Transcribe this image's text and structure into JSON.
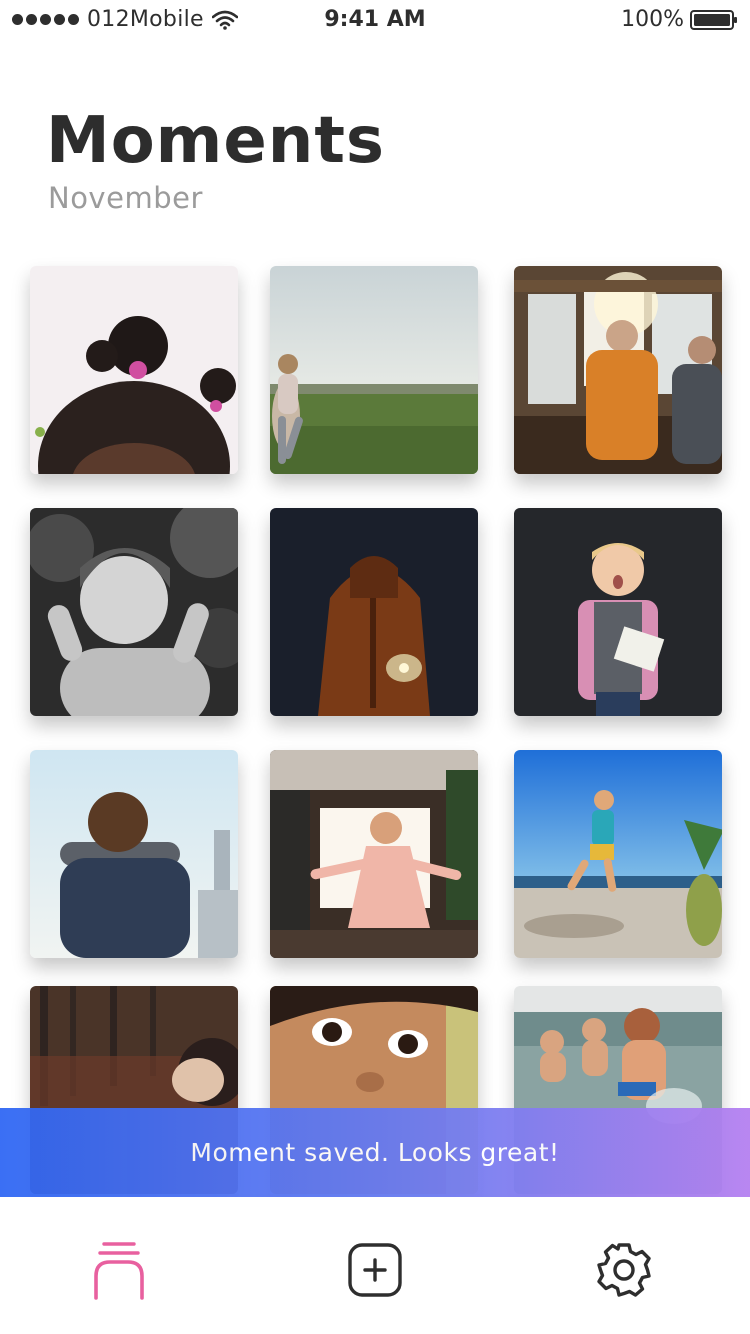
{
  "status_bar": {
    "carrier": "012Mobile",
    "time": "9:41 AM",
    "battery": "100%"
  },
  "header": {
    "title": "Moments",
    "subtitle": "November"
  },
  "grid": {
    "photos": [
      {
        "subject": "child-hair-buns"
      },
      {
        "subject": "girl-running-field"
      },
      {
        "subject": "men-at-window"
      },
      {
        "subject": "boy-black-white"
      },
      {
        "subject": "child-with-sparkler"
      },
      {
        "subject": "surprised-boy-with-book"
      },
      {
        "subject": "child-at-binoculars"
      },
      {
        "subject": "girl-dancing"
      },
      {
        "subject": "boy-on-beach"
      },
      {
        "subject": "child-in-forest"
      },
      {
        "subject": "child-close-up"
      },
      {
        "subject": "kids-in-water"
      }
    ]
  },
  "toast": {
    "message": "Moment saved. Looks great!",
    "colors": [
      "#2e66f3",
      "#b47ff0"
    ]
  },
  "tab_bar": {
    "items": [
      {
        "icon": "moments-stack-icon",
        "active": true
      },
      {
        "icon": "add-square-icon",
        "active": false
      },
      {
        "icon": "gear-icon",
        "active": false
      }
    ],
    "active_color": "#e8609f",
    "inactive_color": "#2e2e2e"
  }
}
